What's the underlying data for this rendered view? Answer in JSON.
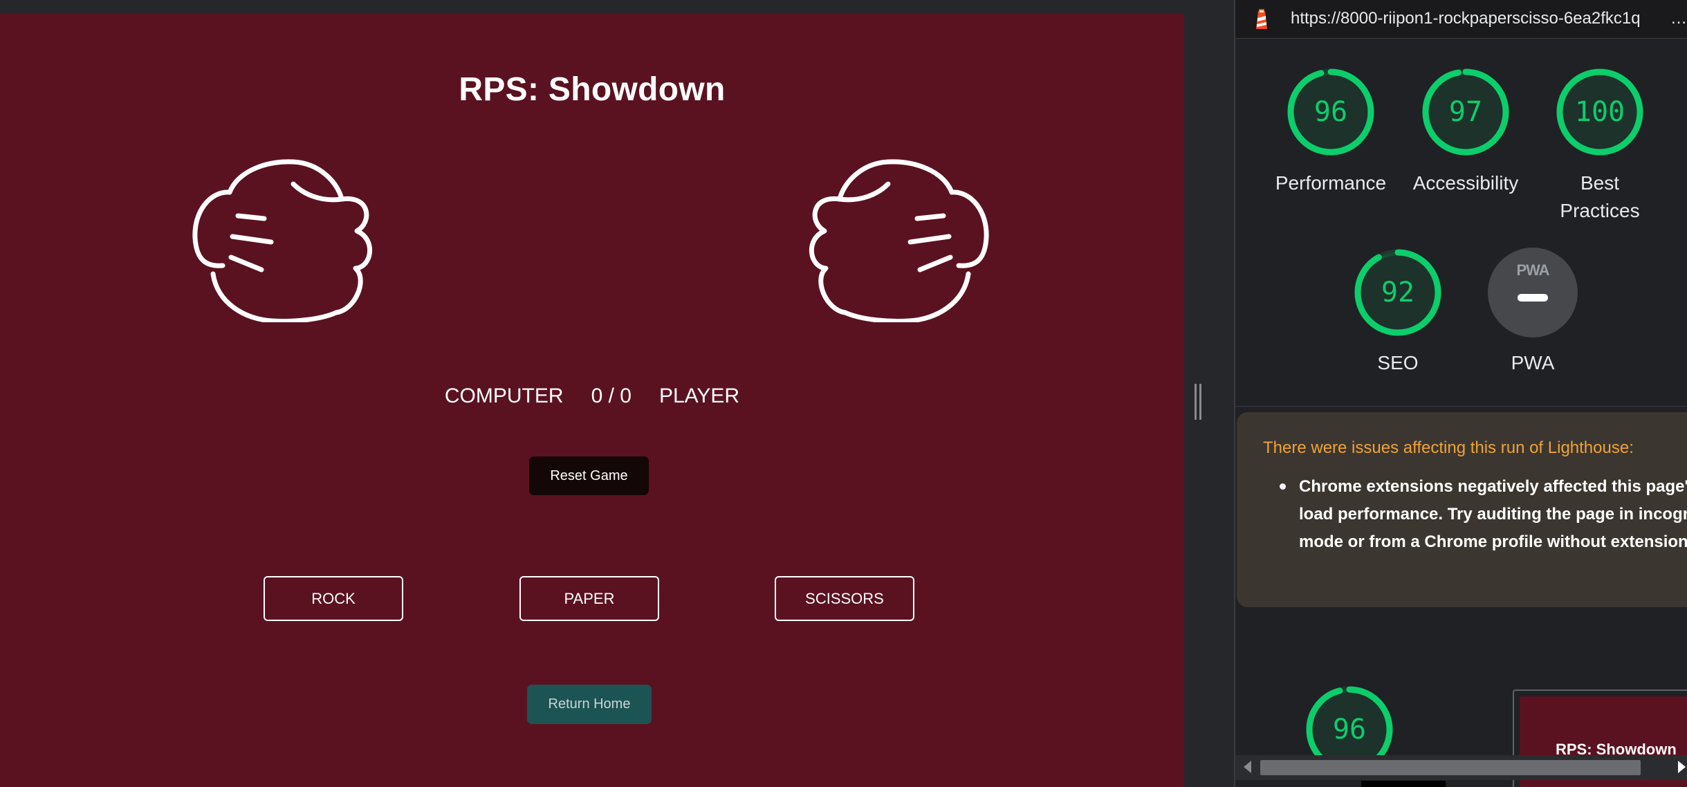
{
  "game": {
    "title": "RPS: Showdown",
    "score": {
      "computer_label": "COMPUTER",
      "value": "0 / 0",
      "player_label": "PLAYER"
    },
    "reset_label": "Reset Game",
    "choices": [
      "ROCK",
      "PAPER",
      "SCISSORS"
    ],
    "return_label": "Return Home",
    "colors": {
      "background": "#5b1220",
      "reset_button": "#140707",
      "return_button": "#1c5453"
    }
  },
  "lighthouse": {
    "url": "https://8000-riipon1-rockpaperscisso-6ea2fkc1q",
    "url_more": "…",
    "scores": [
      {
        "label": "Performance",
        "value": 96
      },
      {
        "label": "Accessibility",
        "value": 97
      },
      {
        "label": "Best Practices",
        "value": 100
      },
      {
        "label": "SEO",
        "value": 92
      }
    ],
    "pwa": {
      "badge": "PWA",
      "label": "PWA"
    },
    "warning": {
      "title": "There were issues affecting this run of Lighthouse:",
      "item": "Chrome extensions negatively affected this page's load performance. Try auditing the page in incognito mode or from a Chrome profile without extensions."
    },
    "bottom_gauge": {
      "value": 96
    },
    "thumbnail_title": "RPS: Showdown",
    "colors": {
      "pass": "#0cce6b",
      "warning": "#f0a23a"
    },
    "icons": [
      "lighthouse-icon"
    ]
  }
}
